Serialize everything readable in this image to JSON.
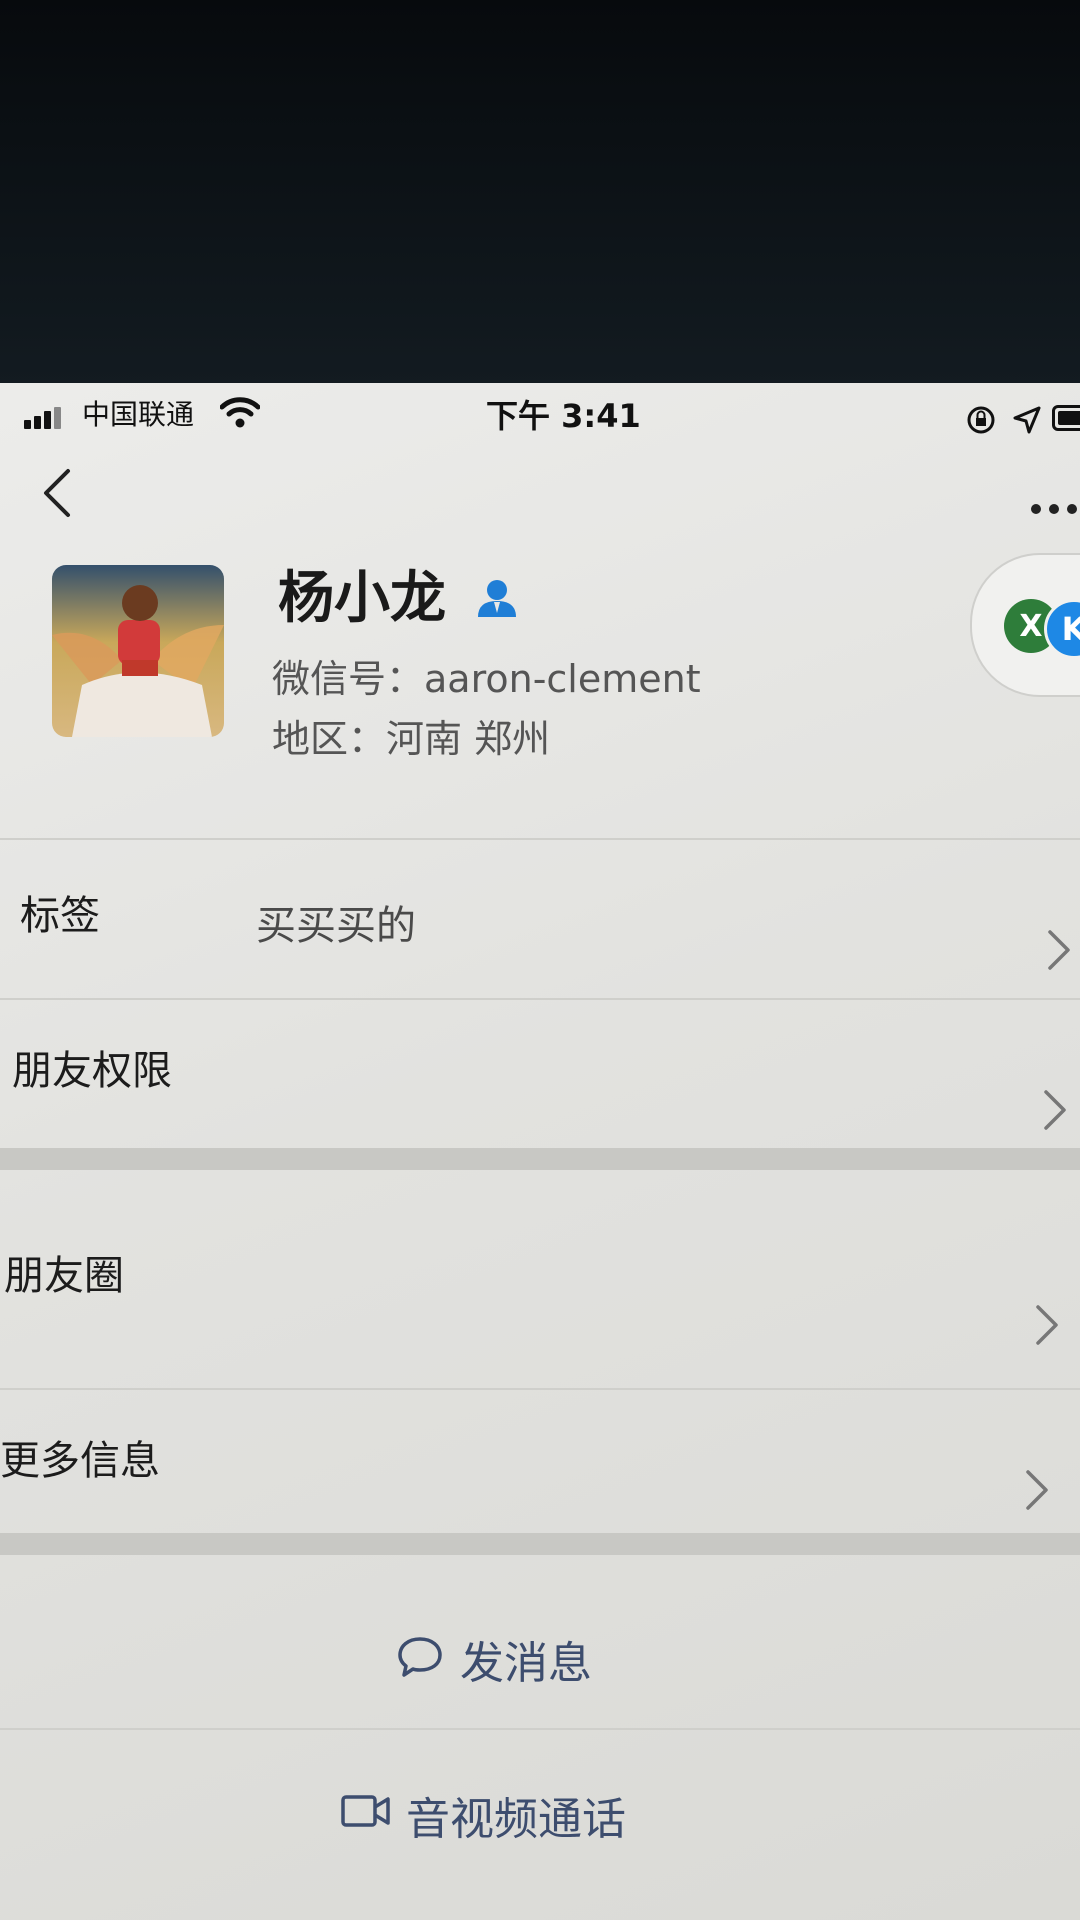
{
  "status_bar": {
    "carrier": "中国联通",
    "time": "下午 3:41"
  },
  "profile": {
    "name": "杨小龙",
    "wechat_id": "微信号：aaron-clement",
    "region": "地区：河南 郑州",
    "badge_letters": [
      "X",
      "K"
    ]
  },
  "rows": {
    "tag_label": "标签",
    "tag_value": "买买买的",
    "friend_permission": "朋友权限",
    "moments": "朋友圈",
    "more_info": "更多信息"
  },
  "actions": {
    "send_message": "发消息",
    "av_call": "音视频通话"
  },
  "colors": {
    "action_text": "#3d4d6e",
    "verified_blue": "#1f7ed6"
  }
}
